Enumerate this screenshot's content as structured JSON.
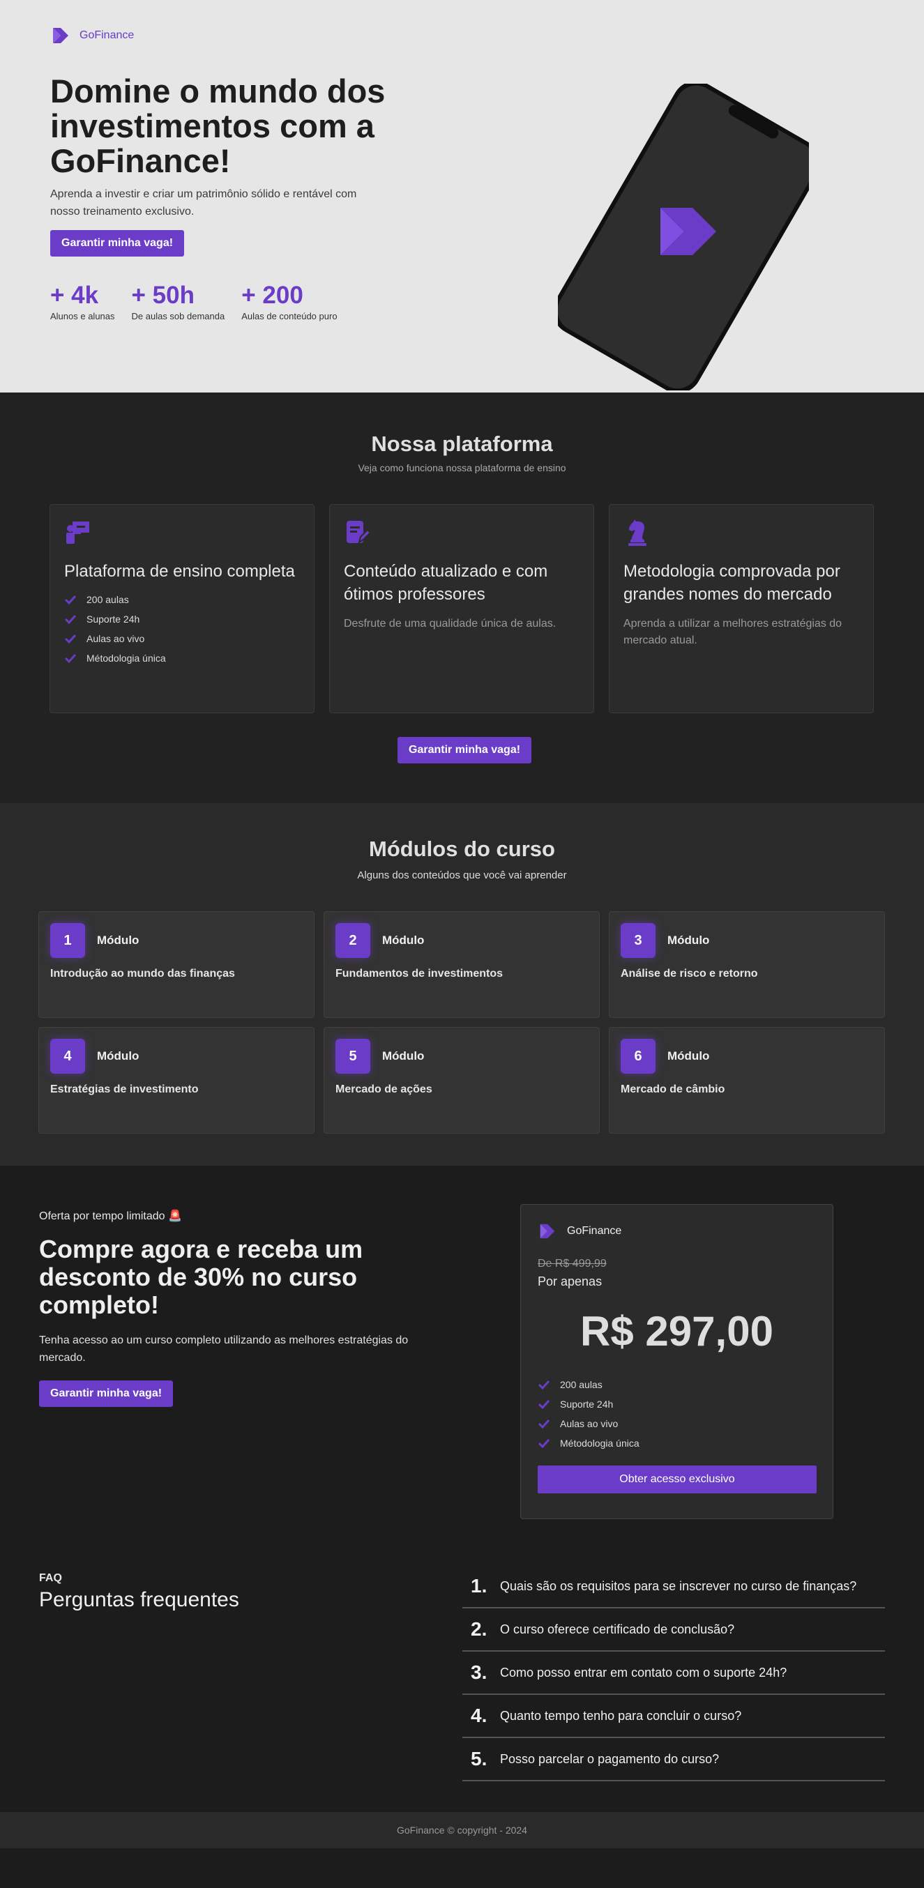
{
  "brand": {
    "name": "GoFinance",
    "accent": "#6a3cc7"
  },
  "hero": {
    "title": "Domine o mundo dos investimentos com a GoFinance!",
    "subtitle": "Aprenda a investir e criar um patrimônio sólido e rentável com nosso treinamento exclusivo.",
    "cta": "Garantir minha vaga!",
    "stats": [
      {
        "value": "+ 4k",
        "label": "Alunos e alunas"
      },
      {
        "value": "+ 50h",
        "label": "De aulas sob demanda"
      },
      {
        "value": "+ 200",
        "label": "Aulas de conteúdo puro"
      }
    ]
  },
  "platform": {
    "title": "Nossa plataforma",
    "subtitle": "Veja como funciona nossa plataforma de ensino",
    "cards": [
      {
        "icon": "chalkboard-teacher-icon",
        "title": "Plataforma de ensino completa",
        "items": [
          "200 aulas",
          "Suporte 24h",
          "Aulas ao vivo",
          "Métodologia única"
        ]
      },
      {
        "icon": "file-edit-icon",
        "title": "Conteúdo atualizado e com ótimos professores",
        "text": "Desfrute de uma qualidade única de aulas."
      },
      {
        "icon": "chess-knight-icon",
        "title": "Metodologia comprovada por grandes nomes do mercado",
        "text": "Aprenda a utilizar a melhores estratégias do mercado atual."
      }
    ],
    "cta": "Garantir minha vaga!"
  },
  "modules": {
    "title": "Módulos do curso",
    "subtitle": "Alguns dos conteúdos que você vai aprender",
    "label": "Módulo",
    "items": [
      {
        "n": "1",
        "title": "Introdução ao mundo das finanças"
      },
      {
        "n": "2",
        "title": "Fundamentos de investimentos"
      },
      {
        "n": "3",
        "title": "Análise de risco e retorno"
      },
      {
        "n": "4",
        "title": "Estratégias de investimento"
      },
      {
        "n": "5",
        "title": "Mercado de ações"
      },
      {
        "n": "6",
        "title": "Mercado de câmbio"
      }
    ]
  },
  "offer": {
    "tag": "Oferta por tempo limitado",
    "tag_icon": "🚨",
    "title": "Compre agora e receba um desconto de 30% no curso completo!",
    "description": "Tenha acesso ao um curso completo utilizando as melhores estratégias do mercado.",
    "cta": "Garantir minha vaga!",
    "card": {
      "brand": "GoFinance",
      "old_price": "De R$ 499,99",
      "per": "Por apenas",
      "price": "R$ 297,00",
      "items": [
        "200 aulas",
        "Suporte 24h",
        "Aulas ao vivo",
        "Métodologia única"
      ],
      "cta": "Obter acesso exclusivo"
    }
  },
  "faq": {
    "kicker": "FAQ",
    "title": "Perguntas frequentes",
    "items": [
      {
        "n": "1.",
        "q": "Quais são os requisitos para se inscrever no curso de finanças?"
      },
      {
        "n": "2.",
        "q": "O curso oferece certificado de conclusão?"
      },
      {
        "n": "3.",
        "q": "Como posso entrar em contato com o suporte 24h?"
      },
      {
        "n": "4.",
        "q": "Quanto tempo tenho para concluir o curso?"
      },
      {
        "n": "5.",
        "q": "Posso parcelar o pagamento do curso?"
      }
    ]
  },
  "footer": {
    "text": "GoFinance © copyright - 2024"
  }
}
